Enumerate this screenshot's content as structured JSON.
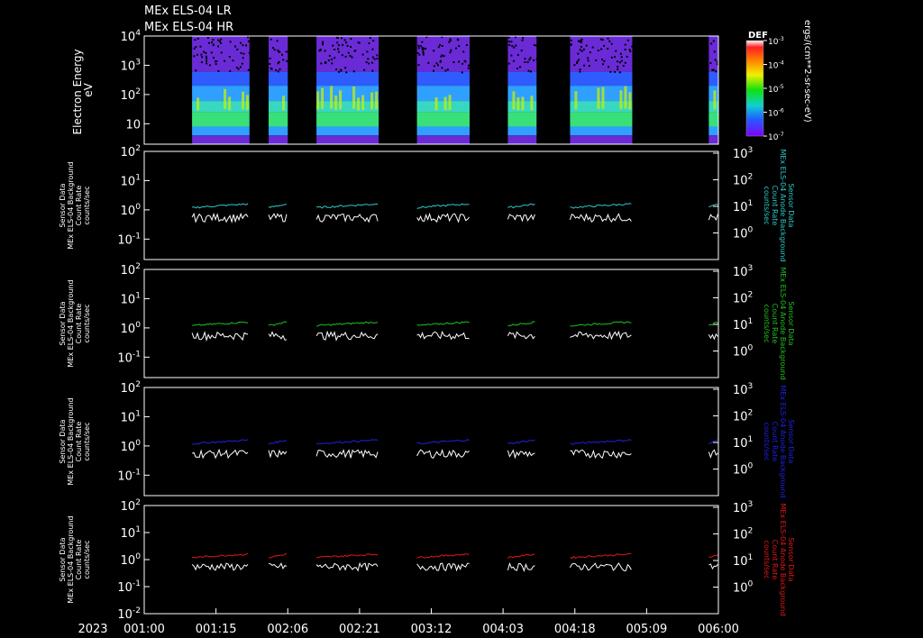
{
  "titles": [
    "MEx ELS-04 LR",
    "MEx ELS-04 HR"
  ],
  "time_axis": {
    "year": "2023",
    "ticks": [
      "001:00",
      "001:15",
      "002:06",
      "002:21",
      "003:12",
      "004:03",
      "004:18",
      "005:09",
      "006:00"
    ]
  },
  "spectrogram": {
    "ylabel": [
      "Electron Energy",
      "eV"
    ],
    "yticks": [
      {
        "base": "10",
        "exp": "4",
        "value": 10000
      },
      {
        "base": "10",
        "exp": "3",
        "value": 1000
      },
      {
        "base": "10",
        "exp": "2",
        "value": 100
      },
      {
        "base": "10",
        "exp": "",
        "value": 10
      }
    ],
    "colorbar": {
      "label": "DEF",
      "units": "ergs/(cm**2-sr-sec-eV)",
      "ticks": [
        {
          "base": "10",
          "exp": "-3"
        },
        {
          "base": "10",
          "exp": "-4"
        },
        {
          "base": "10",
          "exp": "-5"
        },
        {
          "base": "10",
          "exp": "-6"
        },
        {
          "base": "10",
          "exp": "-7"
        }
      ]
    }
  },
  "panel_labels": {
    "left": [
      "Sensor Data",
      "MEx ELS-04 Background",
      "Count Rate",
      "counts/sec"
    ],
    "right": [
      "Sensor Data",
      "MEx ELS-04 Anode Background",
      "Count Rate",
      "counts/sec"
    ]
  },
  "panels": [
    {
      "color": "#2ec8c8",
      "left_ticks": [
        {
          "base": "10",
          "exp": "2"
        },
        {
          "base": "10",
          "exp": "1"
        },
        {
          "base": "10",
          "exp": "0"
        },
        {
          "base": "10",
          "exp": "-1"
        }
      ],
      "right_ticks": [
        {
          "base": "10",
          "exp": "3"
        },
        {
          "base": "10",
          "exp": "2"
        },
        {
          "base": "10",
          "exp": "1"
        },
        {
          "base": "10",
          "exp": "0"
        }
      ]
    },
    {
      "color": "#20c020",
      "left_ticks": [
        {
          "base": "10",
          "exp": "2"
        },
        {
          "base": "10",
          "exp": "1"
        },
        {
          "base": "10",
          "exp": "0"
        },
        {
          "base": "10",
          "exp": "-1"
        }
      ],
      "right_ticks": [
        {
          "base": "10",
          "exp": "3"
        },
        {
          "base": "10",
          "exp": "2"
        },
        {
          "base": "10",
          "exp": "1"
        },
        {
          "base": "10",
          "exp": "0"
        }
      ]
    },
    {
      "color": "#2020e0",
      "left_ticks": [
        {
          "base": "10",
          "exp": "2"
        },
        {
          "base": "10",
          "exp": "1"
        },
        {
          "base": "10",
          "exp": "0"
        },
        {
          "base": "10",
          "exp": "-1"
        }
      ],
      "right_ticks": [
        {
          "base": "10",
          "exp": "3"
        },
        {
          "base": "10",
          "exp": "2"
        },
        {
          "base": "10",
          "exp": "1"
        },
        {
          "base": "10",
          "exp": "0"
        }
      ]
    },
    {
      "color": "#e01818",
      "left_ticks": [
        {
          "base": "10",
          "exp": "2"
        },
        {
          "base": "10",
          "exp": "1"
        },
        {
          "base": "10",
          "exp": "0"
        },
        {
          "base": "10",
          "exp": "-1"
        },
        {
          "base": "10",
          "exp": "-2"
        }
      ],
      "right_ticks": [
        {
          "base": "10",
          "exp": "3"
        },
        {
          "base": "10",
          "exp": "2"
        },
        {
          "base": "10",
          "exp": "1"
        },
        {
          "base": "10",
          "exp": "0"
        }
      ]
    }
  ],
  "chart_data": {
    "type": "line",
    "x_unit": "day-of-year 2023, hours since 001:00",
    "xlim": [
      0,
      120
    ],
    "data_segments_hours": [
      [
        10,
        22
      ],
      [
        26,
        30
      ],
      [
        36,
        49
      ],
      [
        57,
        68
      ],
      [
        76,
        82
      ],
      [
        89,
        102
      ],
      [
        118,
        120
      ]
    ],
    "spectrogram": {
      "type": "heatmap",
      "ylabel": "Electron Energy eV",
      "yscale": "log",
      "ylim": [
        2,
        10000
      ],
      "colorbar_label": "DEF",
      "colorbar_units": "ergs/(cm**2-sr-sec-eV)",
      "colorbar_range": [
        1e-07,
        0.001
      ],
      "colorbar_scale": "log"
    },
    "background_panels": [
      {
        "series": [
          {
            "name": "cyan",
            "color": "#2ec8c8",
            "typical_value": 1.2
          },
          {
            "name": "white",
            "color": "#ffffff",
            "typical_value": 0.7
          }
        ],
        "ylim": [
          0.02,
          100
        ],
        "yscale": "log",
        "right_ylim": [
          1,
          1000
        ]
      },
      {
        "series": [
          {
            "name": "green",
            "color": "#20c020",
            "typical_value": 1.2
          },
          {
            "name": "white",
            "color": "#ffffff",
            "typical_value": 0.7
          }
        ],
        "ylim": [
          0.02,
          100
        ],
        "yscale": "log",
        "right_ylim": [
          1,
          1000
        ]
      },
      {
        "series": [
          {
            "name": "blue",
            "color": "#2020e0",
            "typical_value": 1.2
          },
          {
            "name": "white",
            "color": "#ffffff",
            "typical_value": 0.7
          }
        ],
        "ylim": [
          0.02,
          100
        ],
        "yscale": "log",
        "right_ylim": [
          1,
          1000
        ]
      },
      {
        "series": [
          {
            "name": "red",
            "color": "#e01818",
            "typical_value": 1.2
          },
          {
            "name": "white",
            "color": "#ffffff",
            "typical_value": 0.7
          }
        ],
        "ylim": [
          0.01,
          100
        ],
        "yscale": "log",
        "right_ylim": [
          1,
          1000
        ]
      }
    ]
  }
}
